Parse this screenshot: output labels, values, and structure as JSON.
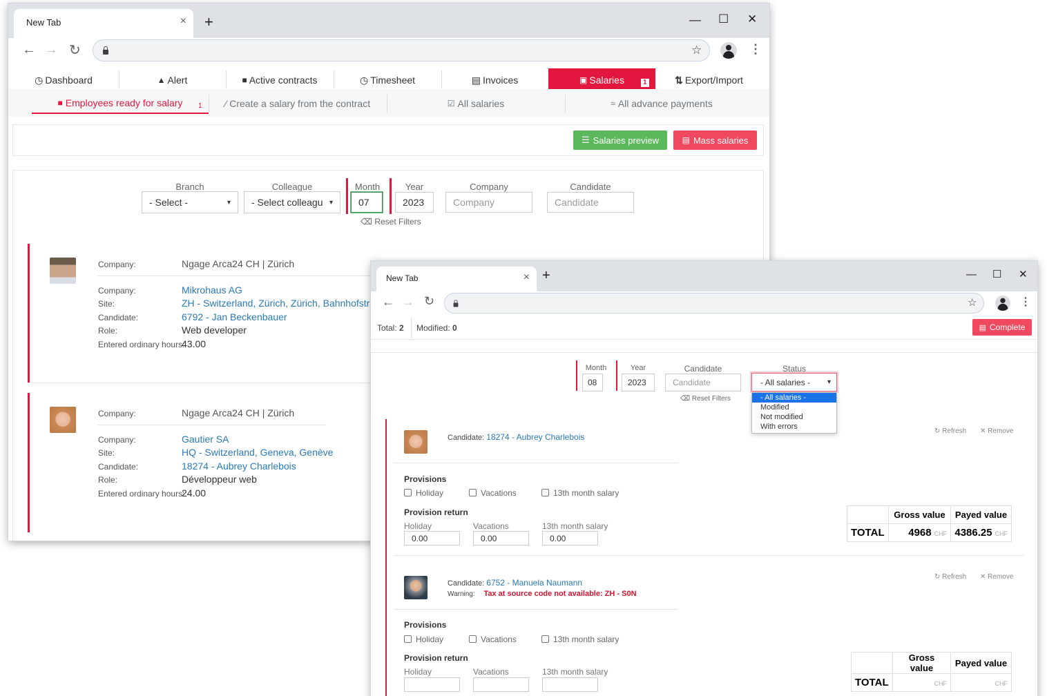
{
  "browser": {
    "tab_title": "New Tab",
    "tab_close": "×",
    "new_tab": "+",
    "minimize": "—",
    "maximize": "☐",
    "close": "✕"
  },
  "nav": {
    "items": [
      {
        "label": "Dashboard",
        "icon": "dashboard-icon",
        "glyph": "◷"
      },
      {
        "label": "Alert",
        "icon": "bell-icon",
        "glyph": "🔔"
      },
      {
        "label": "Active contracts",
        "icon": "briefcase-icon",
        "glyph": "💼"
      },
      {
        "label": "Timesheet",
        "icon": "clock-icon",
        "glyph": "◷"
      },
      {
        "label": "Invoices",
        "icon": "file-icon",
        "glyph": "▤"
      },
      {
        "label": "Salaries",
        "icon": "money-icon",
        "glyph": "💸",
        "badge": "1",
        "active": true
      },
      {
        "label": "Export/Import",
        "icon": "sort-icon",
        "glyph": "⇅"
      }
    ],
    "active_color": "#e3173e"
  },
  "subnav": {
    "items": [
      {
        "label": "Employees ready for salary",
        "badge": "1",
        "icon": "briefcase-icon",
        "active": true
      },
      {
        "label": "Create a salary from the contract",
        "icon": "magic-wand-icon"
      },
      {
        "label": "All salaries",
        "icon": "check-square-icon"
      },
      {
        "label": "All advance payments",
        "icon": "money-icon"
      }
    ]
  },
  "actions": {
    "salaries_preview": "Salaries preview",
    "mass_salaries": "Mass salaries",
    "green": "#5cb85c",
    "red": "#f0485f"
  },
  "filters": {
    "branch_label": "Branch",
    "branch_value": "- Select -",
    "colleague_label": "Colleague",
    "colleague_value": "- Select colleagu",
    "month_label": "Month",
    "month_value": "07",
    "year_label": "Year",
    "year_value": "2023",
    "company_label": "Company",
    "company_placeholder": "Company",
    "candidate_label": "Candidate",
    "candidate_placeholder": "Candidate",
    "reset": "Reset Filters"
  },
  "employees": [
    {
      "company_label": "Company:",
      "agency": "Ngage Arca24 CH | Zürich",
      "client_label": "Company:",
      "client": "Mikrohaus AG",
      "site_label": "Site:",
      "site": "ZH - Switzerland, Zürich, Zürich, Bahnhofstrass",
      "candidate_label": "Candidate:",
      "candidate": "6792 - Jan Beckenbauer",
      "role_label": "Role:",
      "role": "Web developer",
      "hours_label": "Entered ordinary hours:",
      "hours": "43.00"
    },
    {
      "company_label": "Company:",
      "agency": "Ngage Arca24 CH | Zürich",
      "client_label": "Company:",
      "client": "Gautier SA",
      "site_label": "Site:",
      "site": "HQ - Switzerland, Geneva, Genève",
      "candidate_label": "Candidate:",
      "candidate": "18274 - Aubrey Charlebois",
      "role_label": "Role:",
      "role": "Développeur web",
      "hours_label": "Entered ordinary hours:",
      "hours": "24.00"
    }
  ],
  "w2": {
    "total_label": "Total:",
    "total_value": "2",
    "modified_label": "Modified:",
    "modified_value": "0",
    "complete": "Complete",
    "month_label": "Month",
    "month_value": "08",
    "year_label": "Year",
    "year_value": "2023",
    "candidate_label": "Candidate",
    "candidate_placeholder": "Candidate",
    "status_label": "Status",
    "status_value": "- All salaries -",
    "status_options": [
      "- All salaries -",
      "Modified",
      "Not modified",
      "With errors"
    ],
    "reset": "Reset Filters",
    "refresh": "Refresh",
    "remove": "Remove",
    "candidate_prefix": "Candidate:",
    "warning_prefix": "Warning:",
    "provisions": "Provisions",
    "provision_return": "Provision return",
    "holiday": "Holiday",
    "vacations": "Vacations",
    "thirteenth": "13th month salary",
    "gross_value": "Gross value",
    "payed_value": "Payed value",
    "total": "TOTAL",
    "currency": "CHF",
    "salaries": [
      {
        "candidate": "18274 - Aubrey Charlebois",
        "holiday_ret": "0.00",
        "vacations_ret": "0.00",
        "thirteenth_ret": "0.00",
        "gross": "4968",
        "payed": "4386.25"
      },
      {
        "candidate": "6752 - Manuela Naumann",
        "warning": "Tax at source code not available: ZH - S0N",
        "holiday_ret": "",
        "vacations_ret": "",
        "thirteenth_ret": "",
        "gross": "",
        "payed": ""
      }
    ]
  }
}
